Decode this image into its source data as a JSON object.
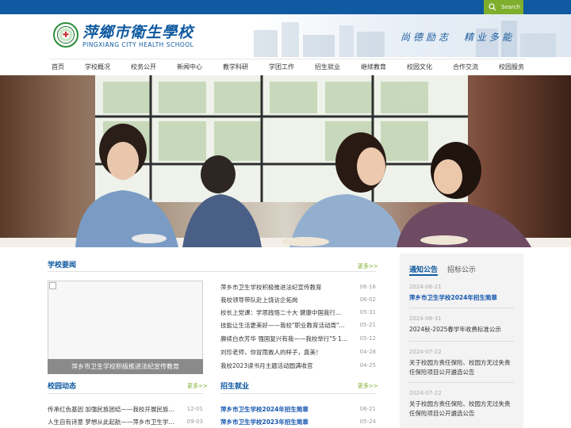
{
  "search": {
    "label": "Search"
  },
  "header": {
    "school_cn": "萍鄉市衛生學校",
    "school_en": "PINGXIANG CITY HEALTH SCHOOL",
    "motto": "尚德励志　精业多能"
  },
  "nav": {
    "items": [
      "首页",
      "学校概况",
      "校务公开",
      "新闻中心",
      "教学科研",
      "学团工作",
      "招生就业",
      "继续教育",
      "校园文化",
      "合作交流",
      "校园服务"
    ]
  },
  "news": {
    "title": "学校要闻",
    "more": "更多>>",
    "image_caption": "萍乡市卫生学校积极推进法纪宣传教育",
    "items": [
      {
        "title": "萍乡市卫生学校积极推进法纪宣传教育",
        "date": "06-16"
      },
      {
        "title": "我校领导带队赴上饶访企拓岗",
        "date": "06-02"
      },
      {
        "title": "校长上党课：学思践悟二十大 健康中国我行...",
        "date": "05-31"
      },
      {
        "title": "技能让生活更美好——我校\"职业教育活动周\"...",
        "date": "05-21"
      },
      {
        "title": "赓续白衣芳华 强国复兴有我——我校举行\"5·1...",
        "date": "05-12"
      },
      {
        "title": "刘珍老师，你冒雨救人的样子，真美！",
        "date": "04-28"
      },
      {
        "title": "我校2023读书月主题活动圆满收官",
        "date": "04-25"
      }
    ]
  },
  "campus": {
    "title": "校园动态",
    "more": "更多>>",
    "items": [
      {
        "title": "传承红色基因 加强民族团结——我校开展民族...",
        "date": "12-01"
      },
      {
        "title": "人生自有诗意 梦想从此起航——萍乡市卫生学...",
        "date": "09-03"
      }
    ]
  },
  "admission": {
    "title": "招生就业",
    "more": "更多>>",
    "items": [
      {
        "title": "萍乡市卫生学校2024年招生简章",
        "date": "06-21"
      },
      {
        "title": "萍乡市卫生学校2023年招生简章",
        "date": "05-24"
      }
    ]
  },
  "notice": {
    "tab_active": "通知公告",
    "tab_inactive": "招标公示",
    "items": [
      {
        "date": "2024-06-21",
        "title": "萍乡市卫生学校2024年招生简章"
      },
      {
        "date": "2024-08-31",
        "title": "2024秋-2025春学年收费标准公示"
      },
      {
        "date": "2024-07-22",
        "title": "关于校园方责任保险、校园方无过失责任保险项目公开遴选公告"
      },
      {
        "date": "2024-07-22",
        "title": "关于校园方责任保险、校园方无过失责任保险项目公开遴选公告"
      }
    ]
  }
}
